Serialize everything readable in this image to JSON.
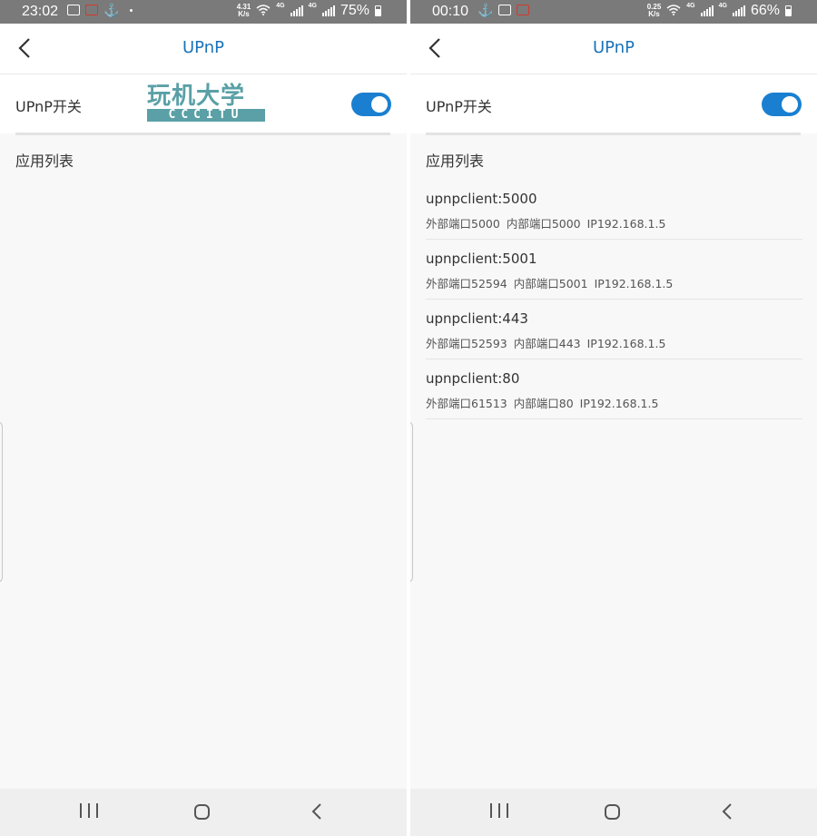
{
  "colors": {
    "accent": "#1a73b8",
    "switch_on": "#1a7fd0",
    "status_bar": "#7a7a7a",
    "watermark": "#5aa0a6"
  },
  "left": {
    "status": {
      "time": "23:02",
      "speed_value": "4.31",
      "speed_unit": "K/s",
      "net1": "4G",
      "net2": "4G",
      "battery": "75%"
    },
    "app_bar": {
      "title": "UPnP"
    },
    "toggle": {
      "label": "UPnP开关",
      "state": "on"
    },
    "watermark": {
      "line1": "玩机大学",
      "line2": "CCCITU"
    },
    "section_title": "应用列表",
    "items": []
  },
  "right": {
    "status": {
      "time": "00:10",
      "speed_value": "0.25",
      "speed_unit": "K/s",
      "net1": "4G",
      "net2": "4G",
      "battery": "66%"
    },
    "app_bar": {
      "title": "UPnP"
    },
    "toggle": {
      "label": "UPnP开关",
      "state": "on"
    },
    "section_title": "应用列表",
    "items": [
      {
        "name": "upnpclient:5000",
        "external": "外部端口5000",
        "internal": "内部端口5000",
        "ip": "IP192.168.1.5"
      },
      {
        "name": "upnpclient:5001",
        "external": "外部端口52594",
        "internal": "内部端口5001",
        "ip": "IP192.168.1.5"
      },
      {
        "name": "upnpclient:443",
        "external": "外部端口52593",
        "internal": "内部端口443",
        "ip": "IP192.168.1.5"
      },
      {
        "name": "upnpclient:80",
        "external": "外部端口61513",
        "internal": "内部端口80",
        "ip": "IP192.168.1.5"
      }
    ]
  }
}
